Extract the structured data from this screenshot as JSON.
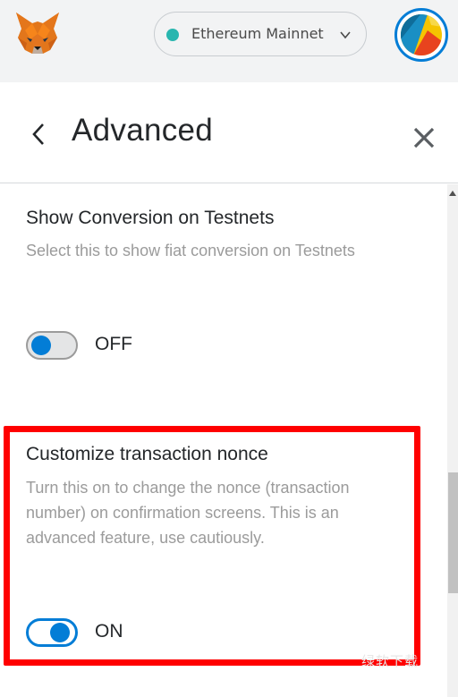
{
  "topbar": {
    "network": {
      "label": "Ethereum Mainnet",
      "dot_color": "#29b6af"
    },
    "logo_icon": "metamask-fox-icon",
    "avatar_icon": "account-avatar"
  },
  "header": {
    "title": "Advanced",
    "back_icon": "chevron-left-icon",
    "close_icon": "close-icon"
  },
  "settings": [
    {
      "title": "Show Conversion on Testnets",
      "description": "Select this to show fiat conversion on Testnets",
      "state": "OFF",
      "enabled": false
    },
    {
      "title": "Customize transaction nonce",
      "description": "Turn this on to change the nonce (transaction number) on confirmation screens. This is an advanced feature, use cautiously.",
      "state": "ON",
      "enabled": true
    }
  ],
  "watermark": "绿软下载",
  "colors": {
    "accent": "#037dd6",
    "highlight": "#ff0000"
  }
}
